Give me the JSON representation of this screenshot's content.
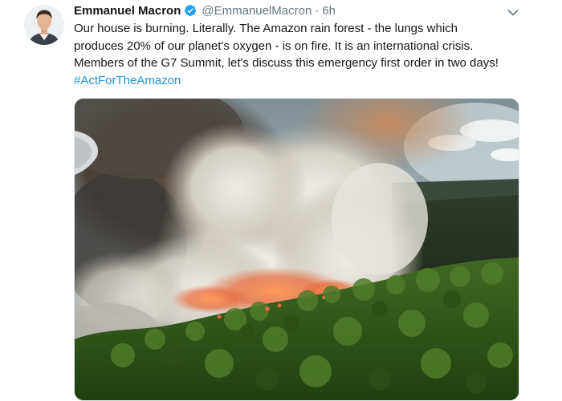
{
  "tweet": {
    "author_name": "Emmanuel Macron",
    "handle": "@EmmanuelMacron",
    "separator": "·",
    "time": "6h",
    "text_lines": [
      "Our house is burning. Literally. The Amazon rain forest - the lungs which",
      "produces 20% of our planet's oxygen - is on fire. It is an international crisis.",
      "Members of the G7 Summit, let's discuss this emergency first order in two days!"
    ],
    "hashtag": "#ActForTheAmazon"
  },
  "icons": {
    "verified": "verified-badge-icon",
    "menu": "chevron-down-icon"
  },
  "colors": {
    "link": "#1b95e0",
    "secondary_text": "#657786",
    "verified": "#1da1f2",
    "primary_text": "#14171a"
  }
}
